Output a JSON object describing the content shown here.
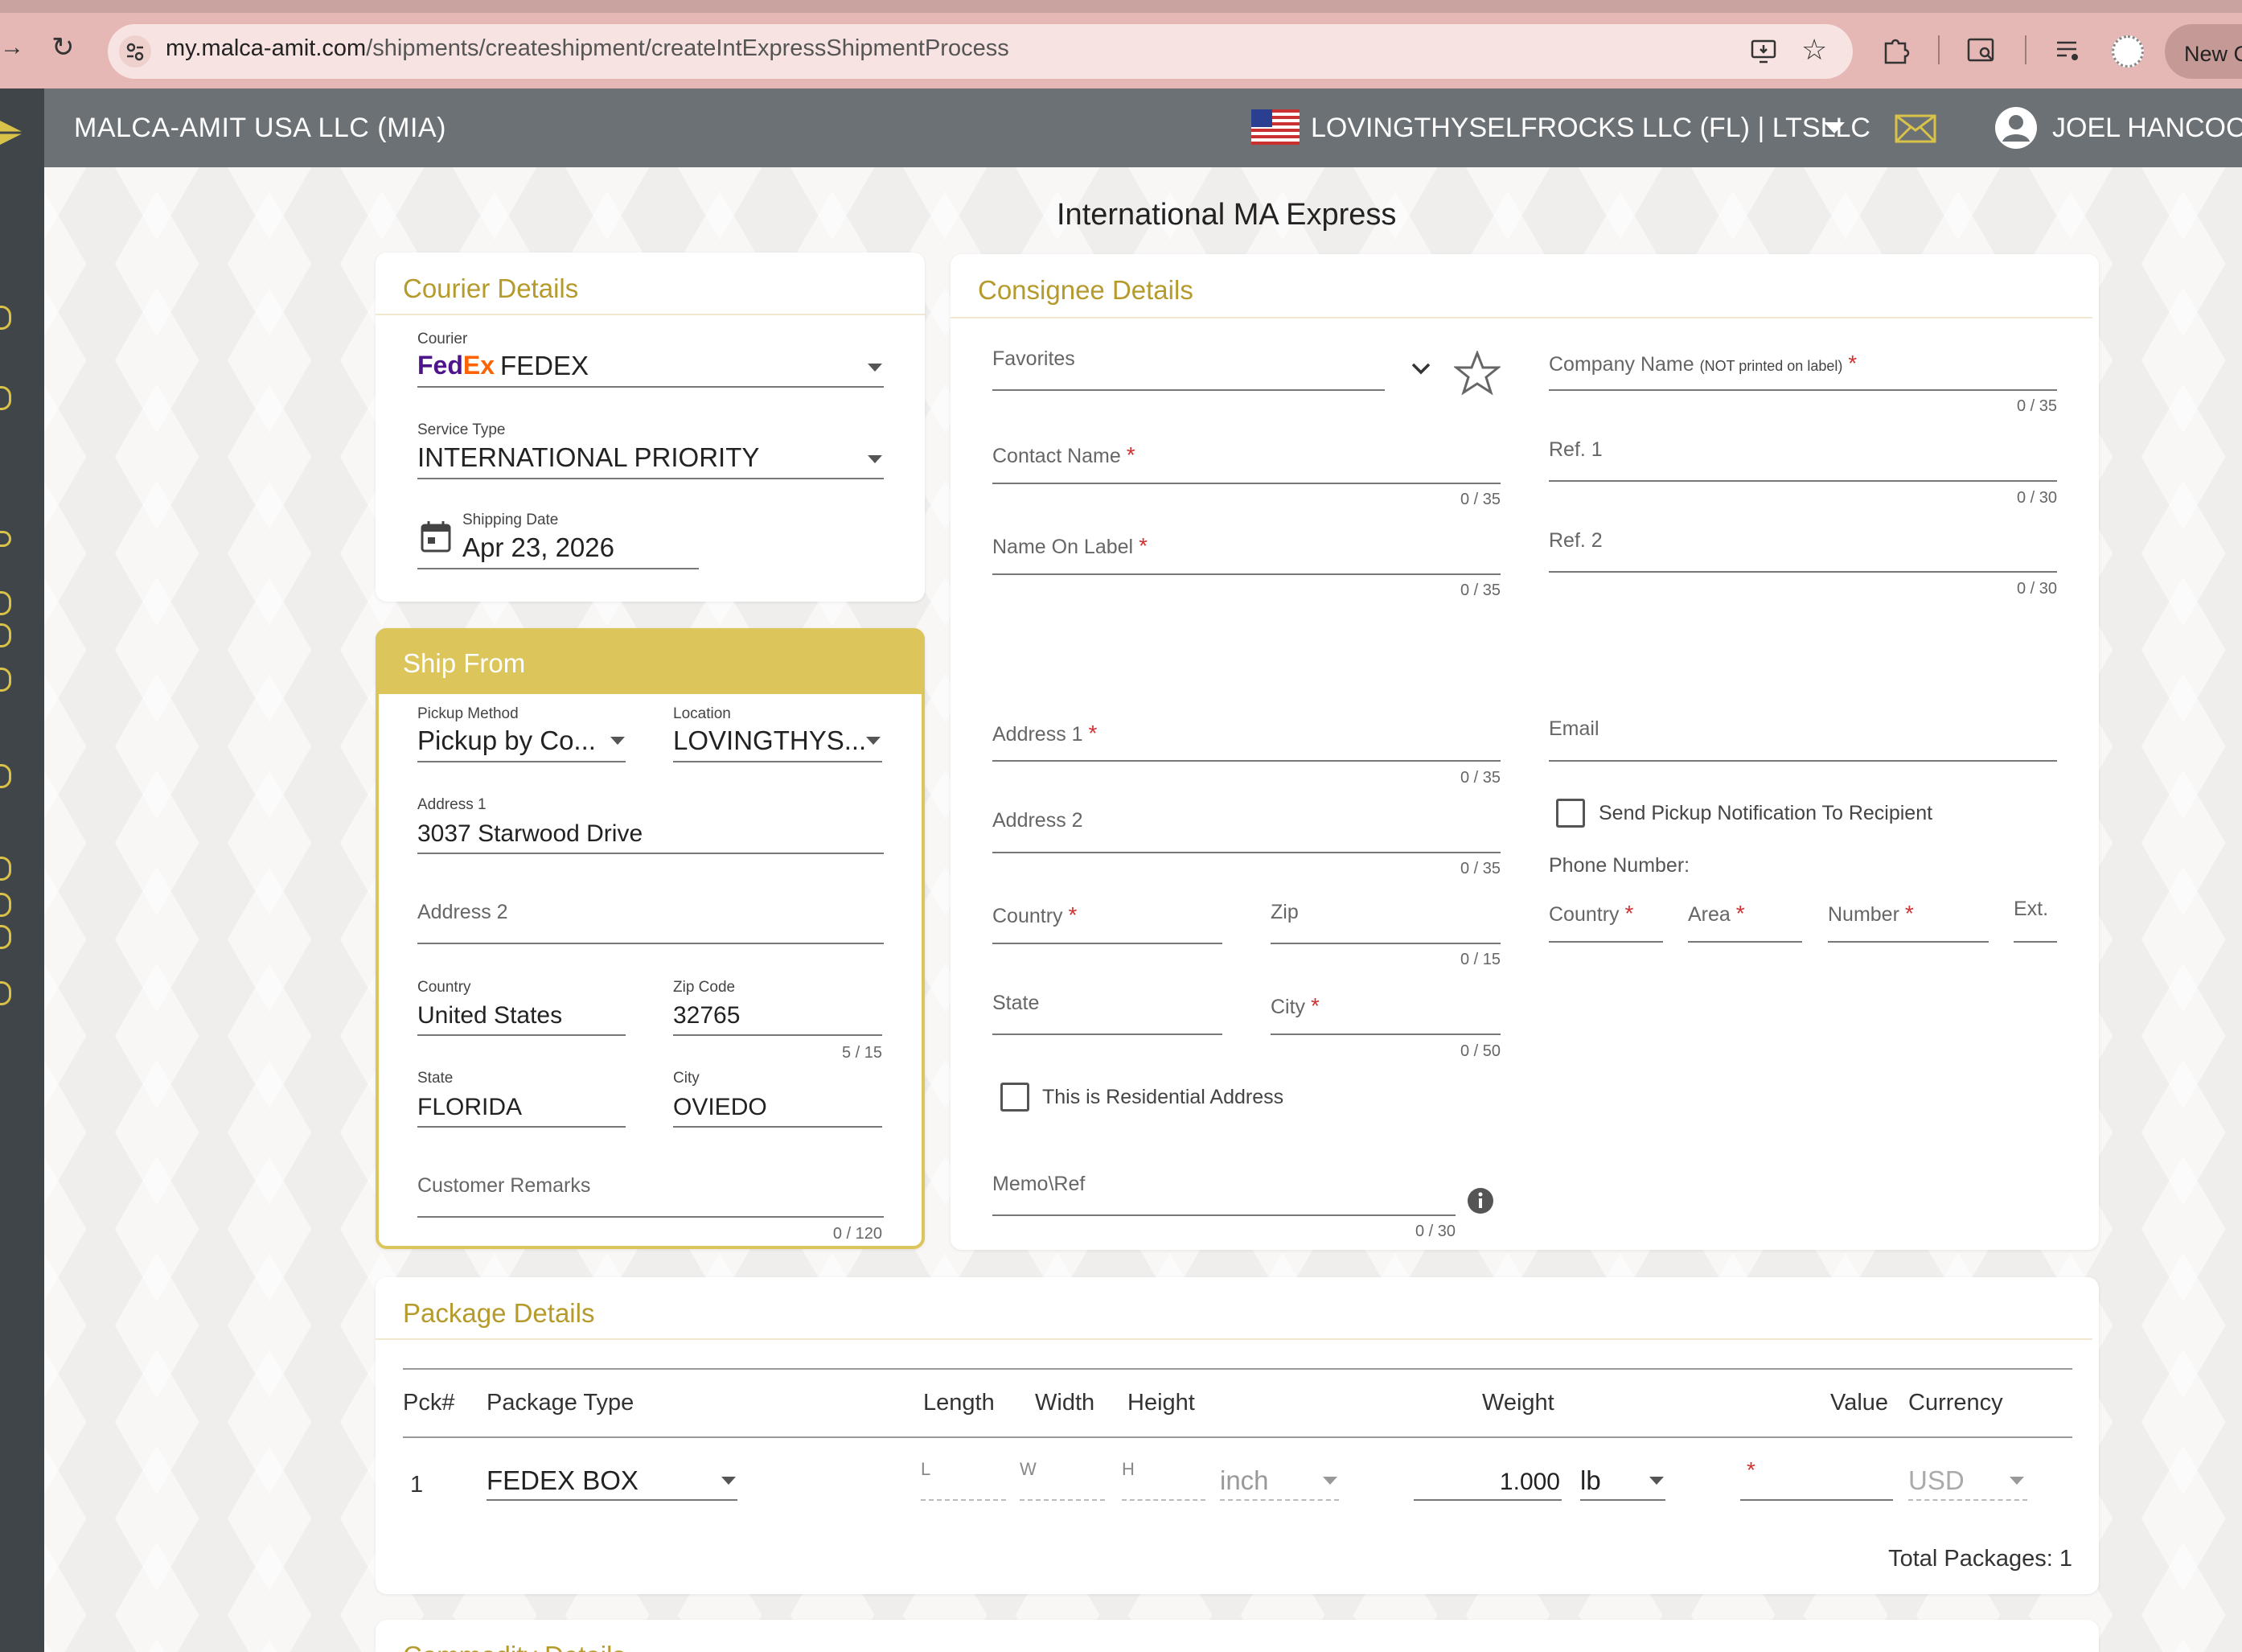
{
  "browser": {
    "url_host": "my.malca-amit.com",
    "url_path": "/shipments/createshipment/createIntExpressShipmentProcess",
    "new_button": "New C"
  },
  "header": {
    "company": "MALCA-AMIT USA LLC (MIA)",
    "account": "LOVINGTHYSELFROCKS LLC (FL) | LTSLLC",
    "user": "JOEL HANCOC"
  },
  "page_title": "International MA Express",
  "courier": {
    "title": "Courier Details",
    "courier_label": "Courier",
    "courier_logo": "FedEx",
    "courier_value": "FEDEX",
    "service_label": "Service Type",
    "service_value": "INTERNATIONAL PRIORITY",
    "date_label": "Shipping Date",
    "date_value": "Apr 23, 2026"
  },
  "ship_from": {
    "title": "Ship From",
    "pickup_label": "Pickup Method",
    "pickup_value": "Pickup by Co...",
    "location_label": "Location",
    "location_value": "LOVINGTHYS...",
    "address1_label": "Address 1",
    "address1_value": "3037 Starwood Drive",
    "address2_placeholder": "Address 2",
    "country_label": "Country",
    "country_value": "United States",
    "zip_label": "Zip Code",
    "zip_value": "32765",
    "zip_counter": "5 / 15",
    "state_label": "State",
    "state_value": "FLORIDA",
    "city_label": "City",
    "city_value": "OVIEDO",
    "remarks_placeholder": "Customer Remarks",
    "remarks_counter": "0 / 120"
  },
  "consignee": {
    "title": "Consignee Details",
    "favorites": "Favorites",
    "company_name": "Company Name",
    "company_note": "(NOT printed on label)",
    "company_counter": "0 / 35",
    "contact_name": "Contact Name",
    "contact_counter": "0 / 35",
    "ref1": "Ref. 1",
    "ref1_counter": "0 / 30",
    "name_on_label": "Name On Label",
    "name_counter": "0 / 35",
    "ref2": "Ref. 2",
    "ref2_counter": "0 / 30",
    "address1": "Address 1",
    "address1_counter": "0 / 35",
    "email": "Email",
    "address2": "Address 2",
    "address2_counter": "0 / 35",
    "send_notification": "Send Pickup Notification To Recipient",
    "phone_number": "Phone Number:",
    "country": "Country",
    "zip": "Zip",
    "zip_counter": "0 / 15",
    "phone_country": "Country",
    "phone_area": "Area",
    "phone_number_field": "Number",
    "phone_ext": "Ext.",
    "state": "State",
    "city": "City",
    "city_counter": "0 / 50",
    "residential": "This is Residential Address",
    "memo": "Memo\\Ref",
    "memo_counter": "0 / 30"
  },
  "package": {
    "title": "Package Details",
    "headers": {
      "pck": "Pck#",
      "type": "Package Type",
      "length": "Length",
      "width": "Width",
      "height": "Height",
      "weight": "Weight",
      "value": "Value",
      "currency": "Currency"
    },
    "row": {
      "num": "1",
      "type": "FEDEX BOX",
      "l": "L",
      "w": "W",
      "h": "H",
      "dim_unit": "inch",
      "weight": "1.000",
      "weight_unit": "lb",
      "currency": "USD"
    },
    "total": "Total Packages: 1"
  },
  "commodity": {
    "title": "Commodity Details"
  },
  "colors": {
    "accent": "#b59a2c",
    "ship_from_header": "#dcc55a",
    "appbar": "#6b7175",
    "required": "#d23131"
  }
}
